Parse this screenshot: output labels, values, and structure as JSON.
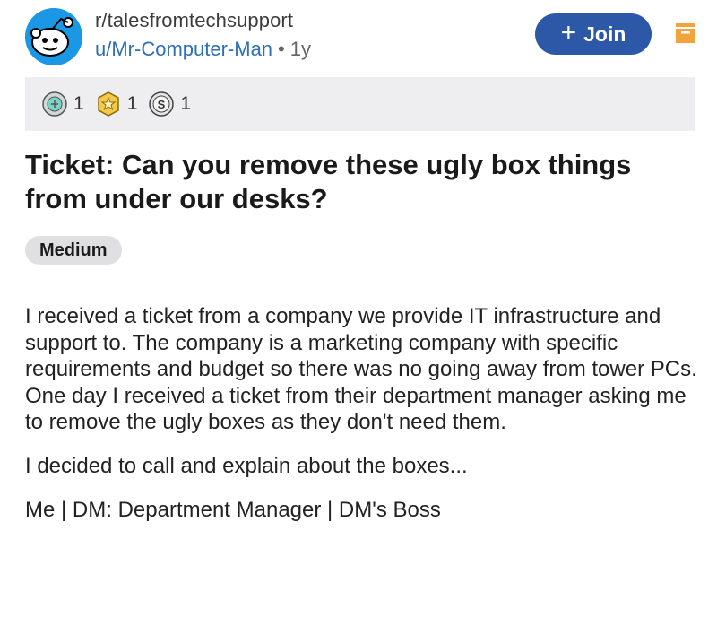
{
  "header": {
    "subreddit": "r/talesfromtechsupport",
    "username": "u/Mr-Computer-Man",
    "separator": "•",
    "age": "1y",
    "join_label": "Join",
    "join_icon": "+"
  },
  "awards": [
    {
      "icon": "helpful-award-icon",
      "count": "1"
    },
    {
      "icon": "wholesome-award-icon",
      "count": "1"
    },
    {
      "icon": "silver-award-icon",
      "count": "1"
    }
  ],
  "post": {
    "title": "Ticket: Can you remove these ugly box things from under our desks?",
    "flair": "Medium",
    "paragraphs": [
      "I received a ticket from a company we provide IT infrastructure and support to. The company is a marketing company with specific requirements and budget so there was no going away from tower PCs. One day I received a ticket from their department manager asking me to remove the ugly boxes as they don't need them.",
      "I decided to call and explain about the boxes...",
      "Me | DM: Department Manager | DM's Boss"
    ]
  },
  "colors": {
    "join_bg": "#2d58a7",
    "username": "#2e6fb5",
    "avatar_bg": "#1a98e6",
    "save_icon": "#f2a33c",
    "awards_bg": "#eeeef0",
    "flair_bg": "#e0e0e2"
  }
}
